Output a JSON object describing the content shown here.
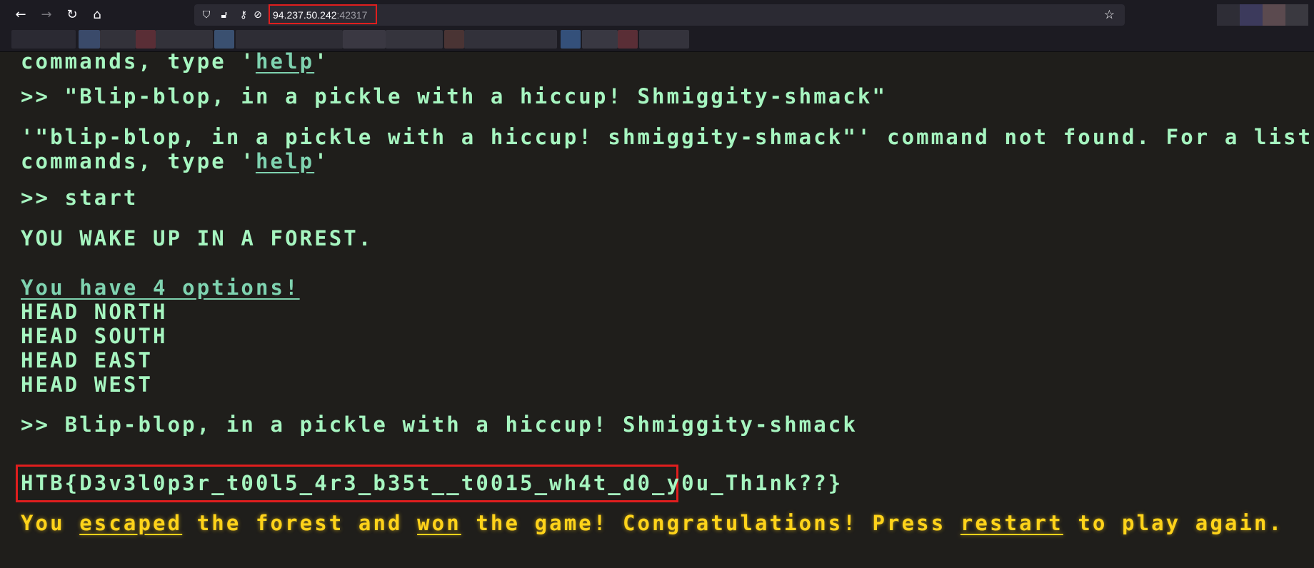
{
  "browser": {
    "url_host": "94.237.50.242",
    "url_port": ":42317",
    "icons": [
      "back-arrow-icon",
      "forward-arrow-icon",
      "reload-icon",
      "home-icon",
      "shield-icon",
      "lock-icon",
      "permissions-icon",
      "tracking-off-icon",
      "bookmark-star-icon"
    ]
  },
  "terminal": {
    "line_top_partial": "commands, type '",
    "help_link": "help",
    "quote_close": "'",
    "cmd1": ">> \"Blip-blop, in a pickle with a hiccup! Shmiggity-shmack\"",
    "err1": "'\"blip-blop, in a pickle with a hiccup! shmiggity-shmack\"' command not found. For a list of",
    "err1_cont": "commands, type '",
    "cmd2": ">> start",
    "wake": "YOU WAKE UP IN A FOREST.",
    "options_header": "You have 4 options!",
    "options": [
      "HEAD NORTH",
      "HEAD SOUTH",
      "HEAD EAST",
      "HEAD WEST"
    ],
    "cmd3": ">> Blip-blop, in a pickle with a hiccup! Shmiggity-shmack",
    "flag": "HTB{D3v3l0p3r_t00l5_4r3_b35t__t0015_wh4t_d0_y0u_Th1nk??}",
    "win_you": "You ",
    "win_escaped": "escaped",
    "win_mid1": " the forest and ",
    "win_won": "won",
    "win_mid2": " the game! Congratulations! Press ",
    "win_restart": "restart",
    "win_end": " to play again."
  },
  "colors": {
    "terminal_bg": "#1f1e1b",
    "terminal_text": "#a6f5c0",
    "win_text": "#ffd31a",
    "highlight_box": "#e01e1e"
  }
}
